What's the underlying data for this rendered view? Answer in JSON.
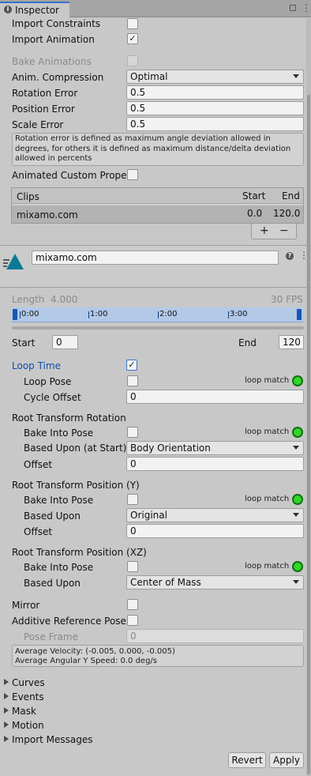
{
  "tab": {
    "title": "Inspector"
  },
  "import": {
    "constraints_label": "Import Constraints",
    "animation_label": "Import Animation",
    "bake_label": "Bake Animations",
    "compression_label": "Anim. Compression",
    "compression_value": "Optimal",
    "rotation_error_label": "Rotation Error",
    "rotation_error_value": "0.5",
    "position_error_label": "Position Error",
    "position_error_value": "0.5",
    "scale_error_label": "Scale Error",
    "scale_error_value": "0.5",
    "help_text": "Rotation error is defined as maximum angle deviation allowed in degrees, for others it is defined as maximum distance/delta deviation allowed in percents",
    "custom_props_label": "Animated Custom Propert"
  },
  "clips": {
    "header": "Clips",
    "col_start": "Start",
    "col_end": "End",
    "rows": [
      {
        "name": "mixamo.com",
        "start": "0.0",
        "end": "120.0"
      }
    ],
    "add": "+",
    "remove": "−"
  },
  "clip": {
    "name": "mixamo.com",
    "length_label": "Length",
    "length_value": "4.000",
    "fps": "30 FPS",
    "timeline_ticks": [
      "0:00",
      "1:00",
      "2:00",
      "3:00"
    ],
    "start_label": "Start",
    "start_value": "0",
    "end_label": "End",
    "end_value": "120",
    "loop_time_label": "Loop Time",
    "loop_pose_label": "Loop Pose",
    "loop_match": "loop match",
    "cycle_offset_label": "Cycle Offset",
    "cycle_offset_value": "0",
    "rot_header": "Root Transform Rotation",
    "bake_into_pose": "Bake Into Pose",
    "rot_based_label": "Based Upon (at Start)",
    "rot_based_value": "Body Orientation",
    "offset_label": "Offset",
    "rot_offset_value": "0",
    "posy_header": "Root Transform Position (Y)",
    "based_label": "Based Upon",
    "posy_based_value": "Original",
    "posy_offset_value": "0",
    "posxz_header": "Root Transform Position (XZ)",
    "posxz_based_value": "Center of Mass",
    "mirror_label": "Mirror",
    "additive_label": "Additive Reference Pose",
    "pose_frame_label": "Pose Frame",
    "pose_frame_value": "0",
    "velocity_text": "Average Velocity: (-0.005, 0.000, -0.005)",
    "angular_text": "Average Angular Y Speed: 0.0 deg/s"
  },
  "foldouts": [
    "Curves",
    "Events",
    "Mask",
    "Motion",
    "Import Messages"
  ],
  "footer": {
    "revert": "Revert",
    "apply": "Apply"
  },
  "colors": {
    "panel": "#c8c8c8",
    "accent": "#0e4eae",
    "loop_ok": "#33d42b",
    "timeline": "#b3c9e8"
  }
}
